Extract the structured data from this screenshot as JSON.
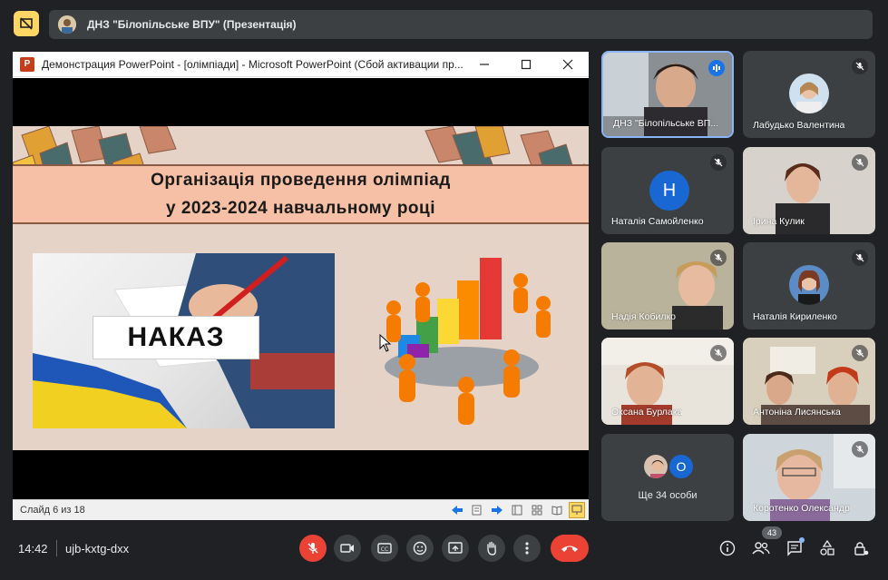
{
  "meeting": {
    "title": "ДНЗ \"Білопільське ВПУ\" (Презентація)"
  },
  "powerpoint": {
    "window_title": "Демонстрация PowerPoint - [олімпіади] - Microsoft PowerPoint (Сбой активации пр...",
    "app_letter": "P",
    "slide_counter": "Слайд 6 из 18",
    "slide": {
      "title_line1": "Організація проведення олімпіад",
      "title_line2": "у 2023-2024 навчальному році",
      "stamp_text": "НАКАЗ"
    }
  },
  "participants": [
    {
      "name": "ДНЗ \"Білопільське ВП...",
      "speaking": true
    },
    {
      "name": "Лабудько Валентина",
      "muted": true
    },
    {
      "name": "Наталія Самойленко",
      "muted": true,
      "initial": "Н"
    },
    {
      "name": "Ірина Кулик",
      "muted": true
    },
    {
      "name": "Надія Кобилко",
      "muted": true
    },
    {
      "name": "Наталія Кириленко",
      "muted": true
    },
    {
      "name": "Оксана Бурлака",
      "muted": true
    },
    {
      "name": "Антоніна Лисянська",
      "muted": true
    },
    {
      "name": "Коротенко Олександр",
      "muted": true
    }
  ],
  "others": {
    "initial": "О",
    "label": "Ще 34 особи"
  },
  "bottom": {
    "time": "14:42",
    "meeting_code": "ujb-kxtg-dxx",
    "people_count": "43"
  },
  "colors": {
    "background": "#202124",
    "tile": "#3c4043",
    "danger": "#ea4335",
    "highlight": "#fdd663",
    "active_border": "#8ab4f8"
  }
}
